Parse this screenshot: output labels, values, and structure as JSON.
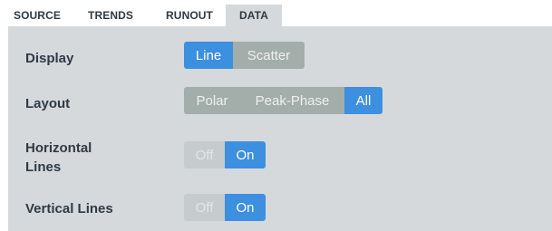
{
  "tabs": [
    {
      "label": "SOURCE"
    },
    {
      "label": "TRENDS"
    },
    {
      "label": "RUNOUT"
    },
    {
      "label": "DATA",
      "active": true
    }
  ],
  "settings": {
    "display": {
      "label": "Display",
      "options": [
        "Line",
        "Scatter"
      ],
      "selected": "Line"
    },
    "layout": {
      "label": "Layout",
      "options": [
        "Polar",
        "Peak-Phase",
        "All"
      ],
      "selected": "All"
    },
    "horizontal_lines": {
      "label_line1": "Horizontal",
      "label_line2": "Lines",
      "options": [
        "Off",
        "On"
      ],
      "selected": "On"
    },
    "vertical_lines": {
      "label": "Vertical Lines",
      "options": [
        "Off",
        "On"
      ],
      "selected": "On"
    }
  },
  "colors": {
    "accent": "#3d8fe0",
    "panel_bg": "#d6d9dc",
    "inactive_option": "#a3adaa",
    "disabled_option": "#c6cbce",
    "label_text": "#2f3a44"
  }
}
